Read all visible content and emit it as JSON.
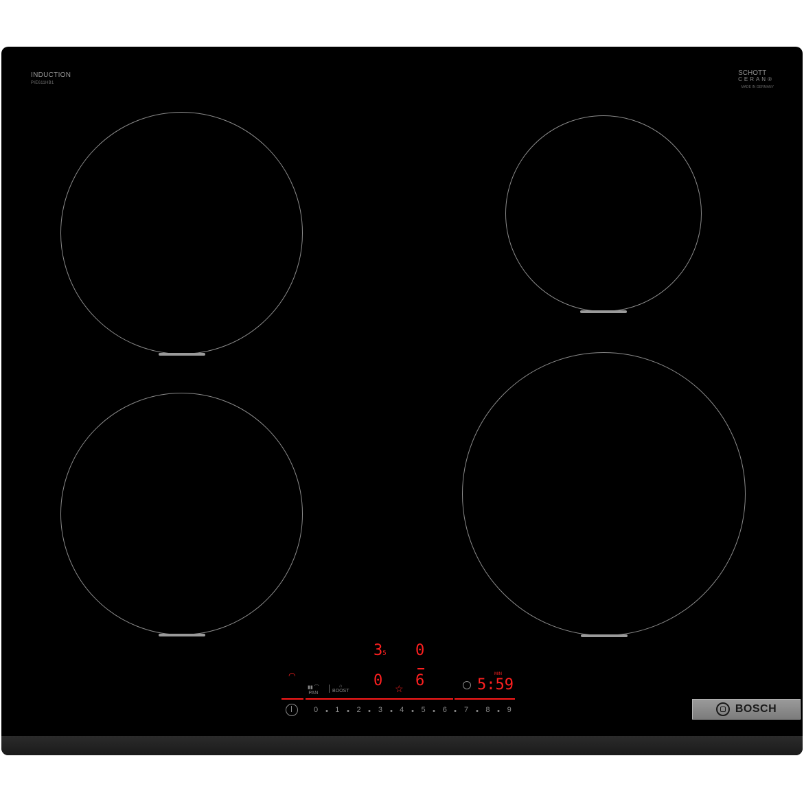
{
  "brand_left": {
    "title": "INDUCTION",
    "model": "PIE611HB1"
  },
  "brand_right": {
    "line1": "SCHOTT",
    "line2": "CERAN",
    "reg": "®",
    "sub": "MADE IN GERMANY"
  },
  "display": {
    "zone_front_left_level": "3",
    "zone_front_left_sub": "5",
    "zone_front_right_level": "0",
    "zone_rear_left_level": "0",
    "zone_rear_right_level": "6",
    "timer_value": "5:59",
    "boost_hint": "MIN"
  },
  "controls": {
    "wifi_label": "",
    "pan_icon_label": "PAN",
    "boost_label": "BOOST"
  },
  "scale": [
    "0",
    "1",
    "2",
    "3",
    "4",
    "5",
    "6",
    "7",
    "8",
    "9"
  ],
  "badge": {
    "brand": "BOSCH"
  },
  "colors": {
    "display_red": "#ff2020",
    "glass": "#000000",
    "frame": "#2b2b2b"
  }
}
